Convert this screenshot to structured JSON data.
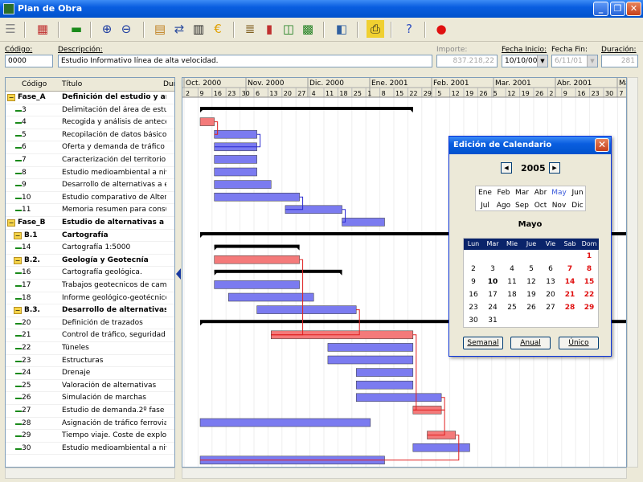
{
  "window": {
    "title": "Plan de Obra"
  },
  "fields": {
    "codigo_label": "Código:",
    "codigo_value": "0000",
    "descripcion_label": "Descripción:",
    "descripcion_value": "Estudio Informativo línea de alta velocidad.",
    "importe_label": "Importe:",
    "importe_value": "837.218,22",
    "inicio_label": "Fecha Inicio:",
    "inicio_value": "10/10/00",
    "fin_label": "Fecha Fin:",
    "fin_value": "6/11/01",
    "duracion_label": "Duración:",
    "duracion_value": "281"
  },
  "grid": {
    "headers": {
      "codigo": "Código",
      "titulo": "Título",
      "dur": "Dur"
    },
    "rows": [
      {
        "code": "Fase_A",
        "title": "Definición del estudio y anal",
        "type": "folder",
        "indent": 0
      },
      {
        "code": "3",
        "title": "Delimitación del área de estudio",
        "type": "task",
        "indent": 0
      },
      {
        "code": "4",
        "title": "Recogida y análisis de anteceden",
        "type": "task",
        "indent": 0
      },
      {
        "code": "5",
        "title": "Recopilación de datos básicos (ca",
        "type": "task",
        "indent": 0
      },
      {
        "code": "6",
        "title": "Oferta y demanda de tráfico ferro",
        "type": "task",
        "indent": 0
      },
      {
        "code": "7",
        "title": "Caracterización del territorio",
        "type": "task",
        "indent": 0
      },
      {
        "code": "8",
        "title": "Estudio medioambiental a nivel zo",
        "type": "task",
        "indent": 0
      },
      {
        "code": "9",
        "title": "Desarrollo de alternativas a escala",
        "type": "task",
        "indent": 0
      },
      {
        "code": "10",
        "title": "Estudio comparativo de Alternatr",
        "type": "task",
        "indent": 0
      },
      {
        "code": "11",
        "title": "Memoria resumen para consultas",
        "type": "task",
        "indent": 0
      },
      {
        "code": "Fase_B",
        "title": "Estudio de alternativas a Es",
        "type": "folder",
        "indent": 0
      },
      {
        "code": "B.1",
        "title": "Cartografía",
        "type": "folder",
        "indent": 1
      },
      {
        "code": "14",
        "title": "Cartografía  1:5000",
        "type": "task",
        "indent": 1
      },
      {
        "code": "B.2.",
        "title": "Geología y Geotecnía",
        "type": "folder",
        "indent": 1
      },
      {
        "code": "16",
        "title": "Cartografía geológica.",
        "type": "task",
        "indent": 1
      },
      {
        "code": "17",
        "title": "Trabajos geotecnicos de campo",
        "type": "task",
        "indent": 1
      },
      {
        "code": "18",
        "title": "Informe geológico-geotécnico.1º",
        "type": "task",
        "indent": 1
      },
      {
        "code": "B.3.",
        "title": "Desarrollo de alternativas a",
        "type": "folder",
        "indent": 1
      },
      {
        "code": "20",
        "title": "Definición de trazados",
        "type": "task",
        "indent": 1
      },
      {
        "code": "21",
        "title": "Control de tráfico, seguridad y co",
        "type": "task",
        "indent": 1
      },
      {
        "code": "22",
        "title": "Túneles",
        "type": "task",
        "indent": 1
      },
      {
        "code": "23",
        "title": "Estructuras",
        "type": "task",
        "indent": 1
      },
      {
        "code": "24",
        "title": "Drenaje",
        "type": "task",
        "indent": 1
      },
      {
        "code": "25",
        "title": "Valoración de alternativas",
        "type": "task",
        "indent": 1
      },
      {
        "code": "26",
        "title": "Simulación de marchas",
        "type": "task",
        "indent": 1
      },
      {
        "code": "27",
        "title": "Estudio de demanda.2º fase",
        "type": "task",
        "indent": 1
      },
      {
        "code": "28",
        "title": "Asignación de tráfico ferroviario a",
        "type": "task",
        "indent": 1
      },
      {
        "code": "29",
        "title": "Tiempo viaje. Coste de explotacio",
        "type": "task",
        "indent": 1
      },
      {
        "code": "30",
        "title": "Estudio medioambiental a nivel de",
        "type": "task",
        "indent": 1
      }
    ]
  },
  "gantt": {
    "months": [
      "Oct. 2000",
      "Nov. 2000",
      "Dic. 2000",
      "Ene. 2001",
      "Feb. 2001",
      "Mar. 2001",
      "Abr. 2001",
      "May. 2"
    ],
    "days": [
      "2",
      "9",
      "16",
      "23",
      "30",
      "6",
      "13",
      "20",
      "27",
      "4",
      "11",
      "18",
      "25",
      "1",
      "8",
      "15",
      "22",
      "29",
      "5",
      "12",
      "19",
      "26",
      "5",
      "12",
      "19",
      "26",
      "2",
      "9",
      "16",
      "23",
      "30",
      "7"
    ],
    "colors": {
      "task": "#7b7bf0",
      "critical": "#f47a7a",
      "summary": "#000000",
      "link": "#2b2bd0",
      "critical_link": "#e02020"
    },
    "bars": [
      {
        "row": 0,
        "start": 0,
        "end": 45,
        "kind": "summary"
      },
      {
        "row": 1,
        "start": 0,
        "end": 3,
        "kind": "critical"
      },
      {
        "row": 2,
        "start": 3,
        "end": 12,
        "kind": "task"
      },
      {
        "row": 3,
        "start": 3,
        "end": 12,
        "kind": "task"
      },
      {
        "row": 4,
        "start": 3,
        "end": 12,
        "kind": "task"
      },
      {
        "row": 5,
        "start": 3,
        "end": 12,
        "kind": "task"
      },
      {
        "row": 6,
        "start": 3,
        "end": 15,
        "kind": "task"
      },
      {
        "row": 7,
        "start": 3,
        "end": 21,
        "kind": "task"
      },
      {
        "row": 8,
        "start": 18,
        "end": 30,
        "kind": "task"
      },
      {
        "row": 9,
        "start": 30,
        "end": 39,
        "kind": "task"
      },
      {
        "row": 10,
        "start": 0,
        "end": 100,
        "kind": "summary"
      },
      {
        "row": 11,
        "start": 3,
        "end": 21,
        "kind": "summary"
      },
      {
        "row": 12,
        "start": 3,
        "end": 21,
        "kind": "critical"
      },
      {
        "row": 13,
        "start": 3,
        "end": 30,
        "kind": "summary"
      },
      {
        "row": 14,
        "start": 3,
        "end": 21,
        "kind": "task"
      },
      {
        "row": 15,
        "start": 6,
        "end": 24,
        "kind": "task"
      },
      {
        "row": 16,
        "start": 12,
        "end": 33,
        "kind": "task"
      },
      {
        "row": 17,
        "start": 0,
        "end": 100,
        "kind": "summary"
      },
      {
        "row": 18,
        "start": 15,
        "end": 45,
        "kind": "critical"
      },
      {
        "row": 19,
        "start": 27,
        "end": 45,
        "kind": "task"
      },
      {
        "row": 20,
        "start": 27,
        "end": 45,
        "kind": "task"
      },
      {
        "row": 21,
        "start": 33,
        "end": 45,
        "kind": "task"
      },
      {
        "row": 22,
        "start": 33,
        "end": 45,
        "kind": "task"
      },
      {
        "row": 23,
        "start": 33,
        "end": 51,
        "kind": "task"
      },
      {
        "row": 24,
        "start": 45,
        "end": 51,
        "kind": "critical"
      },
      {
        "row": 25,
        "start": 0,
        "end": 36,
        "kind": "task"
      },
      {
        "row": 26,
        "start": 48,
        "end": 54,
        "kind": "critical"
      },
      {
        "row": 27,
        "start": 45,
        "end": 57,
        "kind": "task"
      },
      {
        "row": 28,
        "start": 0,
        "end": 39,
        "kind": "task"
      }
    ]
  },
  "dialog": {
    "title": "Edición de Calendario",
    "year": "2005",
    "months": [
      "Ene",
      "Feb",
      "Mar",
      "Abr",
      "May",
      "Jun",
      "Jul",
      "Ago",
      "Sep",
      "Oct",
      "Nov",
      "Dic"
    ],
    "selected_month": "May",
    "month_name": "Mayo",
    "weekdays": [
      "Lun",
      "Mar",
      "Mie",
      "Jue",
      "Vie",
      "Sab",
      "Dom"
    ],
    "weeks": [
      [
        "",
        "",
        "",
        "",
        "",
        "",
        "1"
      ],
      [
        "2",
        "3",
        "4",
        "5",
        "6",
        "7",
        "8"
      ],
      [
        "9",
        "10",
        "11",
        "12",
        "13",
        "14",
        "15"
      ],
      [
        "16",
        "17",
        "18",
        "19",
        "20",
        "21",
        "22"
      ],
      [
        "23",
        "24",
        "25",
        "26",
        "27",
        "28",
        "29"
      ],
      [
        "30",
        "31",
        "",
        "",
        "",
        "",
        ""
      ]
    ],
    "buttons": {
      "semanal": "Semanal",
      "anual": "Anual",
      "unico": "Único"
    }
  }
}
